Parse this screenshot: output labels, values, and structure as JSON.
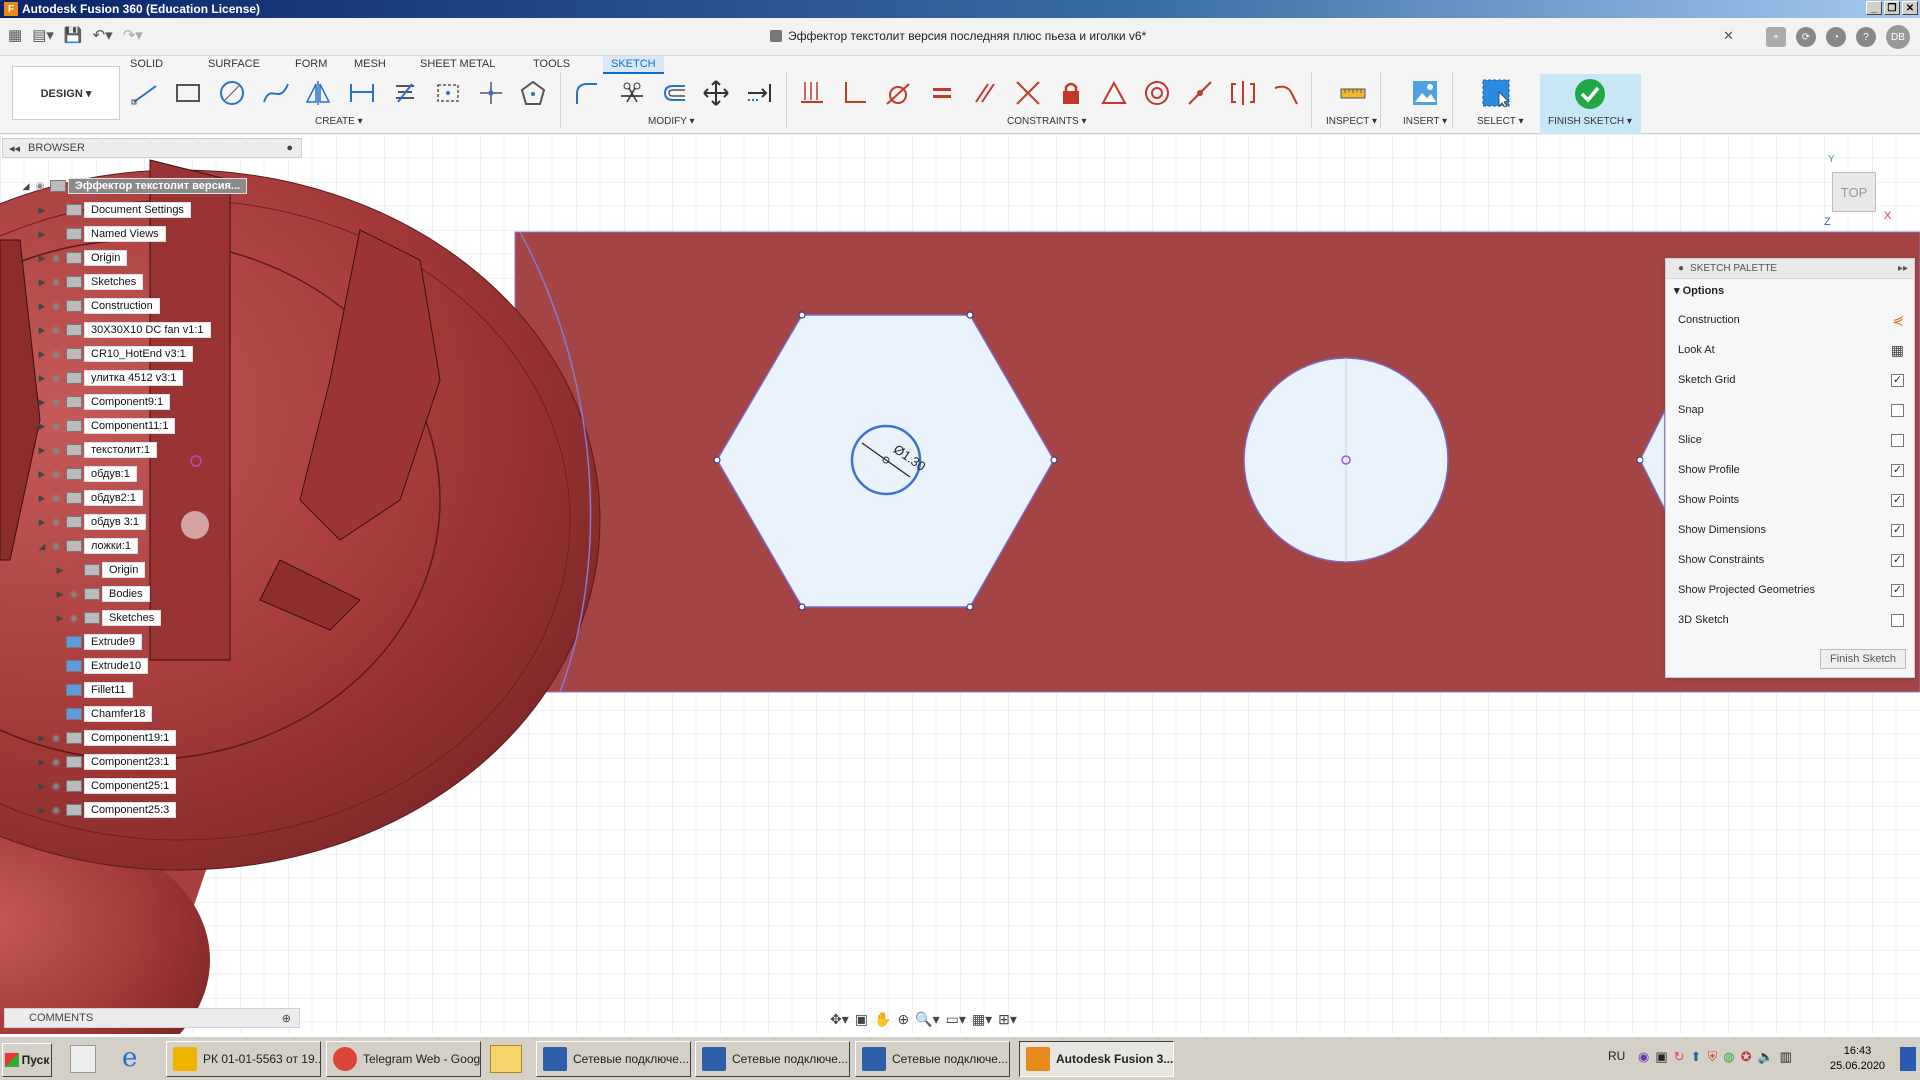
{
  "window": {
    "title": "Autodesk Fusion 360 (Education License)",
    "buttons": [
      "_",
      "❐",
      "✕"
    ]
  },
  "document": {
    "title": "Эффектор текстолит версия последняя плюс пьеза и иголки v6*",
    "close": "✕",
    "user_initials": "DB"
  },
  "ribbon": {
    "tabs": [
      "SOLID",
      "SURFACE",
      "FORM",
      "MESH",
      "SHEET METAL",
      "TOOLS",
      "SKETCH"
    ],
    "active_tab": "SKETCH",
    "workspace": "DESIGN ▾",
    "groups": {
      "create": "CREATE ▾",
      "modify": "MODIFY ▾",
      "constraints": "CONSTRAINTS ▾",
      "inspect": "INSPECT ▾",
      "insert": "INSERT ▾",
      "select": "SELECT ▾",
      "finish": "FINISH SKETCH ▾"
    }
  },
  "browser": {
    "title": "BROWSER",
    "items": [
      {
        "label": "Эффектор текстолит версия..."
      },
      {
        "label": "Document Settings"
      },
      {
        "label": "Named Views"
      },
      {
        "label": "Origin"
      },
      {
        "label": "Sketches"
      },
      {
        "label": "Construction"
      },
      {
        "label": "30X30X10 DC fan  v1:1"
      },
      {
        "label": "CR10_HotEnd v3:1"
      },
      {
        "label": "улитка 4512 v3:1"
      },
      {
        "label": "Component9:1"
      },
      {
        "label": "Component11:1"
      },
      {
        "label": "текстолит:1"
      },
      {
        "label": "обдув:1"
      },
      {
        "label": "обдув2:1"
      },
      {
        "label": "обдув 3:1"
      },
      {
        "label": "ложки:1"
      },
      {
        "label": "Origin"
      },
      {
        "label": "Bodies"
      },
      {
        "label": "Sketches"
      },
      {
        "label": "Extrude9"
      },
      {
        "label": "Extrude10"
      },
      {
        "label": "Fillet11"
      },
      {
        "label": "Chamfer18"
      },
      {
        "label": "Component19:1"
      },
      {
        "label": "Component23:1"
      },
      {
        "label": "Component25:1"
      },
      {
        "label": "Component25:3"
      }
    ]
  },
  "comments": {
    "title": "COMMENTS"
  },
  "viewcube": {
    "face": "TOP",
    "axis_x": "X",
    "axis_y": "Y",
    "axis_z": "Z"
  },
  "sketch": {
    "dimension": "Ø1.30"
  },
  "palette": {
    "title": "SKETCH PALETTE",
    "section": "Options",
    "options": [
      {
        "label": "Construction",
        "type": "icon"
      },
      {
        "label": "Look At",
        "type": "icon"
      },
      {
        "label": "Sketch Grid",
        "checked": true
      },
      {
        "label": "Snap",
        "checked": false
      },
      {
        "label": "Slice",
        "checked": false
      },
      {
        "label": "Show Profile",
        "checked": true
      },
      {
        "label": "Show Points",
        "checked": true
      },
      {
        "label": "Show Dimensions",
        "checked": true
      },
      {
        "label": "Show Constraints",
        "checked": true
      },
      {
        "label": "Show Projected Geometries",
        "checked": true
      },
      {
        "label": "3D Sketch",
        "checked": false
      }
    ],
    "finish_button": "Finish Sketch"
  },
  "taskbar": {
    "start": "Пуск",
    "tasks": [
      {
        "label": "РК 01-01-5563 от 19...",
        "icon": "bitrix-icon",
        "color": "#f0b400"
      },
      {
        "label": "Telegram Web - Goog...",
        "icon": "chrome-icon",
        "color": "#db4437"
      },
      {
        "label": "Сетевые подключе...",
        "icon": "network-icon",
        "color": "#2d5fa8"
      },
      {
        "label": "Сетевые подключе...",
        "icon": "network-icon",
        "color": "#2d5fa8"
      },
      {
        "label": "Сетевые подключе...",
        "icon": "network-icon",
        "color": "#2d5fa8"
      },
      {
        "label": "Autodesk Fusion 3...",
        "icon": "fusion-icon",
        "color": "#e8891c",
        "active": true
      }
    ],
    "lang": "RU",
    "time": "16:43",
    "date": "25.06.2020"
  },
  "colors": {
    "body_red": "#a84848",
    "sketch_fill": "#eaf3fb",
    "sketch_line": "#7a68c6",
    "accent_blue": "#0a6ed1",
    "finish_green": "#21a844"
  }
}
